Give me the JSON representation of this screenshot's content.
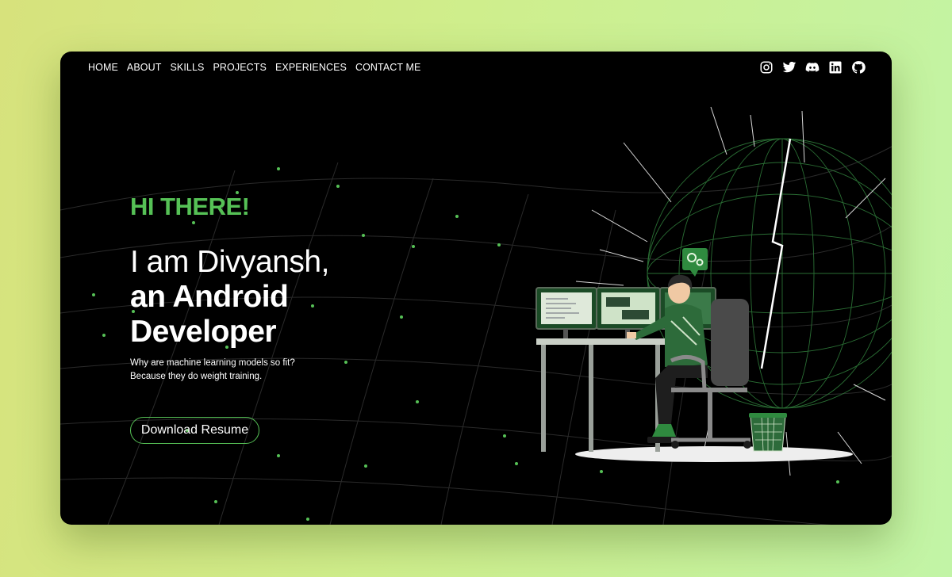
{
  "nav": {
    "items": [
      {
        "label": "HOME"
      },
      {
        "label": "ABOUT"
      },
      {
        "label": "SKILLS"
      },
      {
        "label": "PROJECTS"
      },
      {
        "label": "EXPERIENCES"
      },
      {
        "label": "CONTACT ME"
      }
    ]
  },
  "socials": [
    "instagram-icon",
    "twitter-icon",
    "discord-icon",
    "linkedin-icon",
    "github-icon"
  ],
  "hero": {
    "greeting": "HI THERE!",
    "intro_line1": "I am Divyansh,",
    "intro_line2": "an Android",
    "intro_line3": "Developer",
    "joke_line1": "Why are machine learning models so fit?",
    "joke_line2": "Because they do weight training.",
    "resume_button": "Download Resume"
  },
  "colors": {
    "accent": "#56c156",
    "background": "#000000",
    "text": "#ffffff"
  }
}
